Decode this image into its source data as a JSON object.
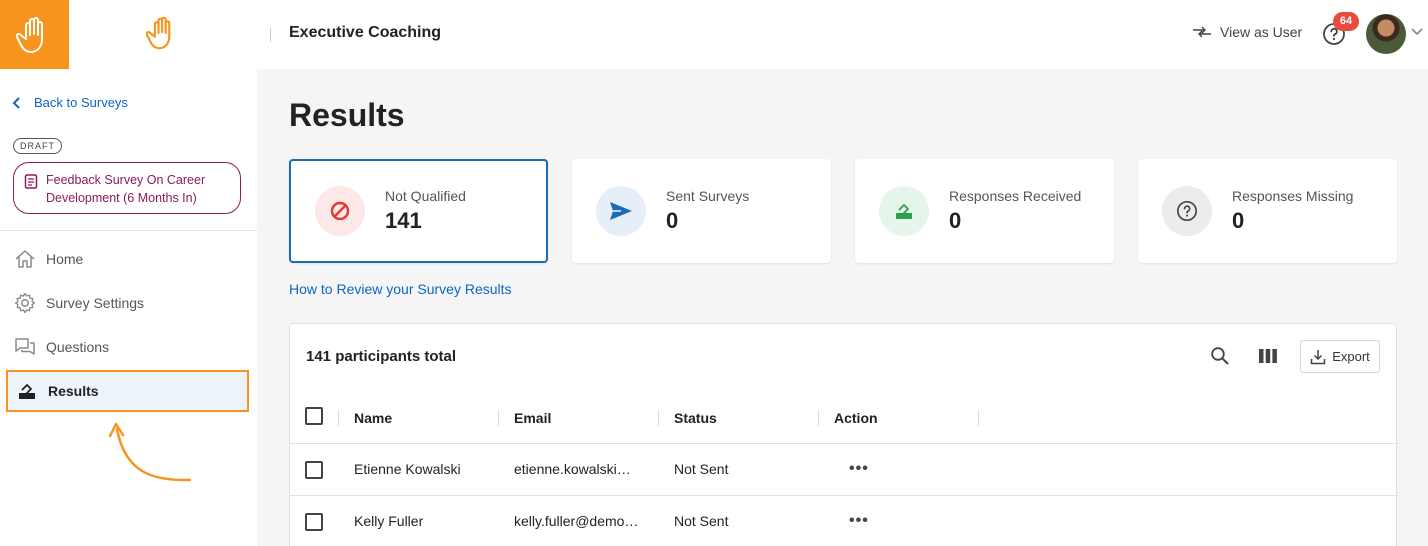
{
  "header": {
    "app_title": "Executive Coaching",
    "view_as_user": "View as User",
    "notification_count": "64"
  },
  "sidebar": {
    "back_label": "Back to Surveys",
    "draft_tag": "DRAFT",
    "survey_name": "Feedback Survey On Career Development (6 Months In)",
    "items": [
      {
        "label": "Home",
        "icon": "home-icon"
      },
      {
        "label": "Survey Settings",
        "icon": "gear-icon"
      },
      {
        "label": "Questions",
        "icon": "chat-icon"
      },
      {
        "label": "Results",
        "icon": "results-icon",
        "active": true
      }
    ]
  },
  "main": {
    "title": "Results",
    "cards": [
      {
        "label": "Not Qualified",
        "value": "141",
        "icon": "block-icon",
        "color": "#e53935"
      },
      {
        "label": "Sent Surveys",
        "value": "0",
        "icon": "send-icon",
        "color": "#1a6bb8"
      },
      {
        "label": "Responses Received",
        "value": "0",
        "icon": "ballot-box-icon",
        "color": "#2e9e4f"
      },
      {
        "label": "Responses Missing",
        "value": "0",
        "icon": "question-icon",
        "color": "#555555"
      }
    ],
    "review_link": "How to Review your Survey Results",
    "table": {
      "total_label": "141 participants total",
      "export_label": "Export",
      "columns": [
        "Name",
        "Email",
        "Status",
        "Action"
      ],
      "rows": [
        {
          "name": "Etienne Kowalski",
          "email": "etienne.kowalski…",
          "status": "Not Sent"
        },
        {
          "name": "Kelly Fuller",
          "email": "kelly.fuller@demo…",
          "status": "Not Sent"
        }
      ]
    }
  },
  "colors": {
    "brand_orange": "#f7941d",
    "link_blue": "#0a66c2",
    "survey_maroon": "#8a1c5b",
    "badge_red": "#e74c3c"
  }
}
